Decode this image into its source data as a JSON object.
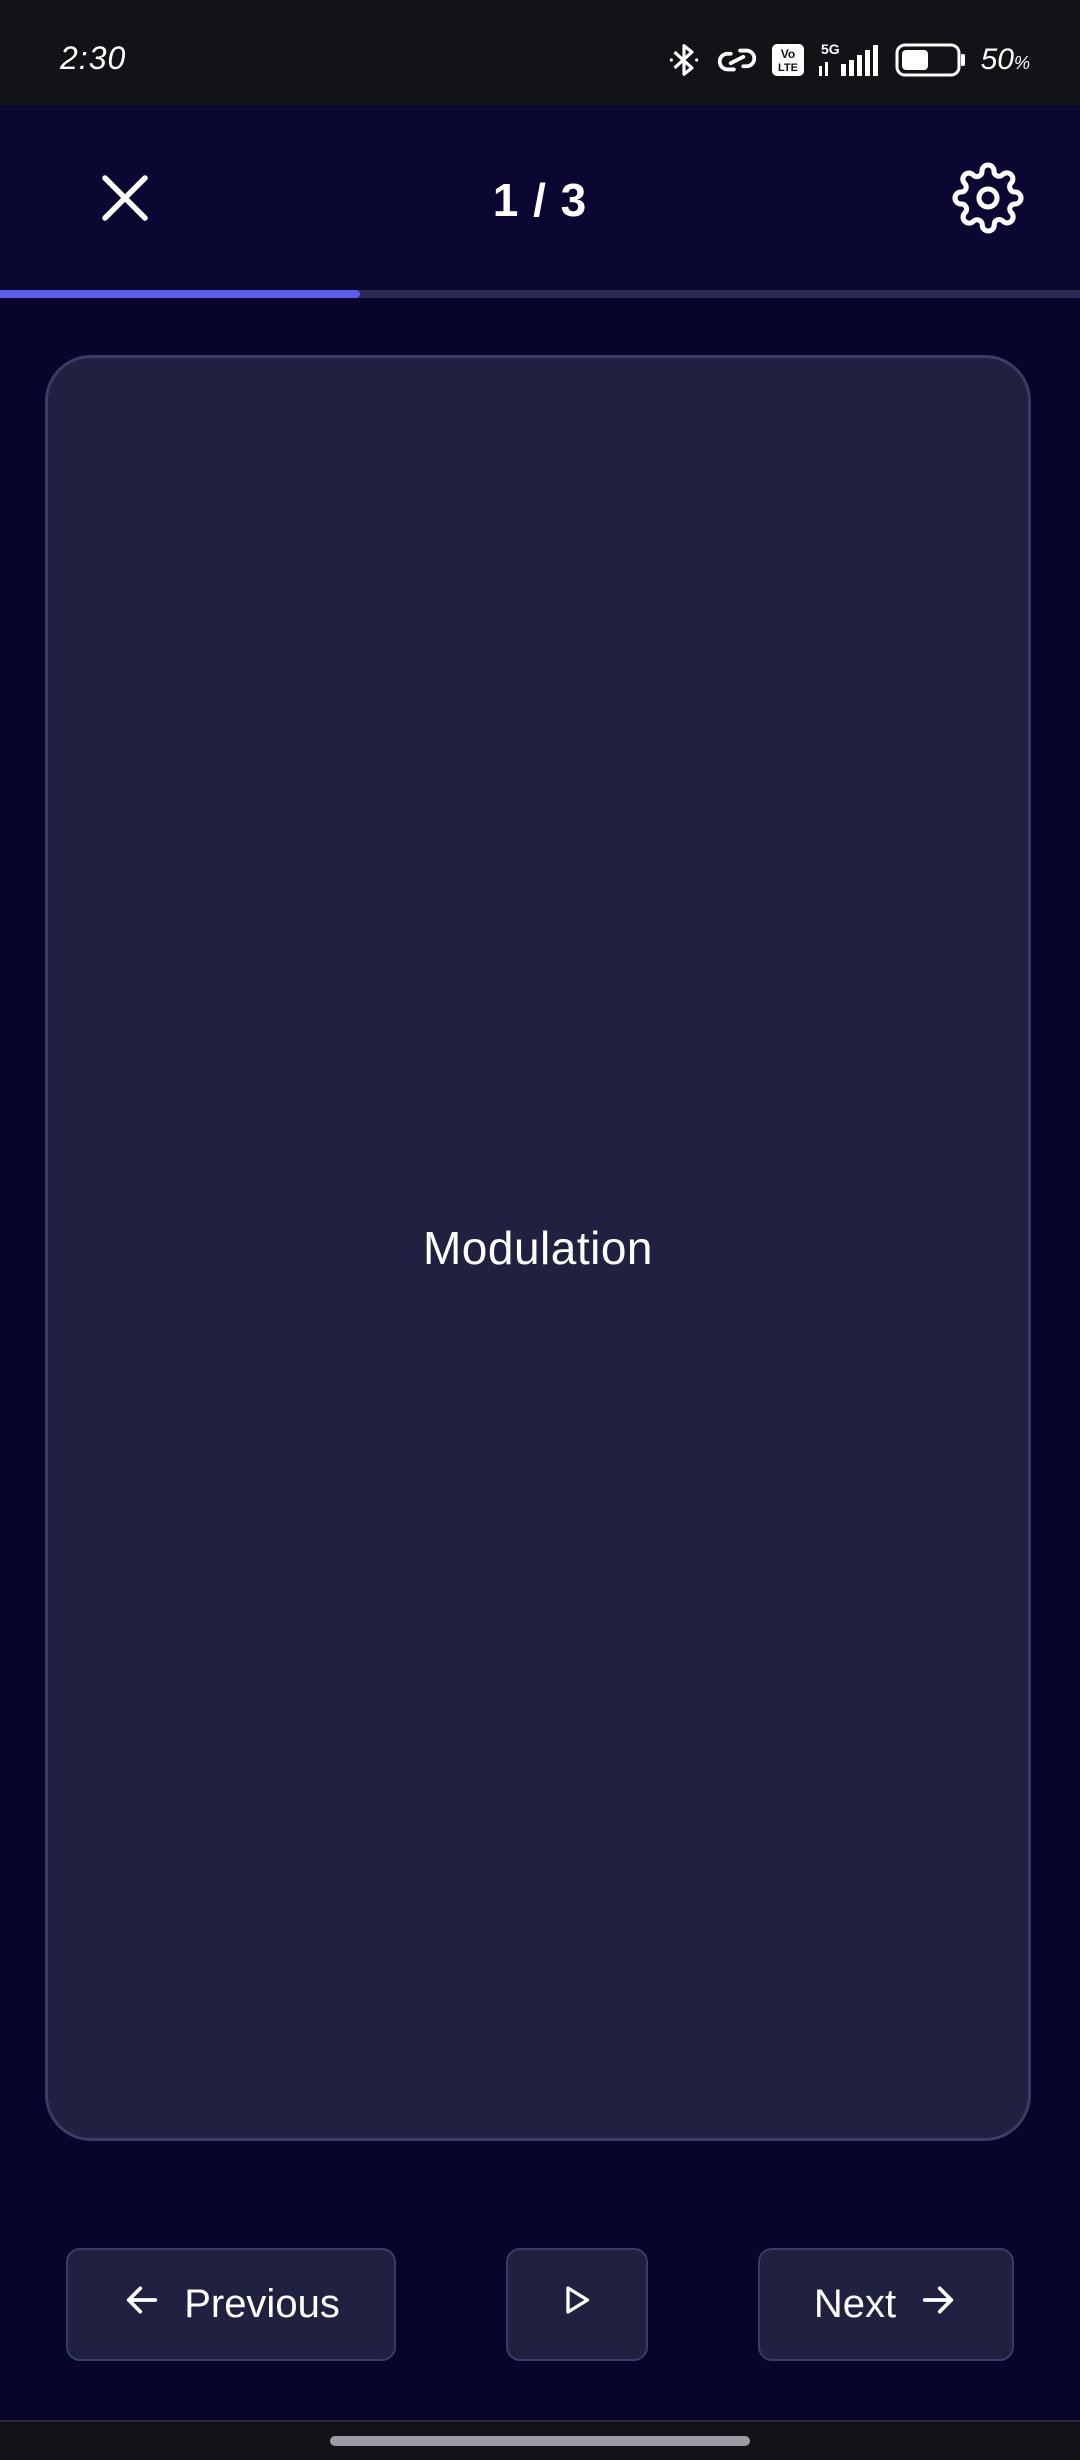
{
  "status_bar": {
    "time": "2:30",
    "network_label": "5G",
    "volte_label": "Vo\nLTE",
    "battery_level": 50,
    "battery_text": "50",
    "battery_unit": "%"
  },
  "header": {
    "close_icon": "close-icon",
    "progress_text": "1 / 3",
    "settings_icon": "gear-icon"
  },
  "progress": {
    "current": 1,
    "total": 3,
    "fraction": 0.333,
    "accent_color": "#5b5ce8",
    "track_color": "#2a2a55"
  },
  "card": {
    "term": "Modulation"
  },
  "controls": {
    "previous_label": "Previous",
    "play_icon": "play-icon",
    "next_label": "Next"
  },
  "colors": {
    "background": "#07052a",
    "card": "#202140",
    "border": "#3a3c66"
  }
}
